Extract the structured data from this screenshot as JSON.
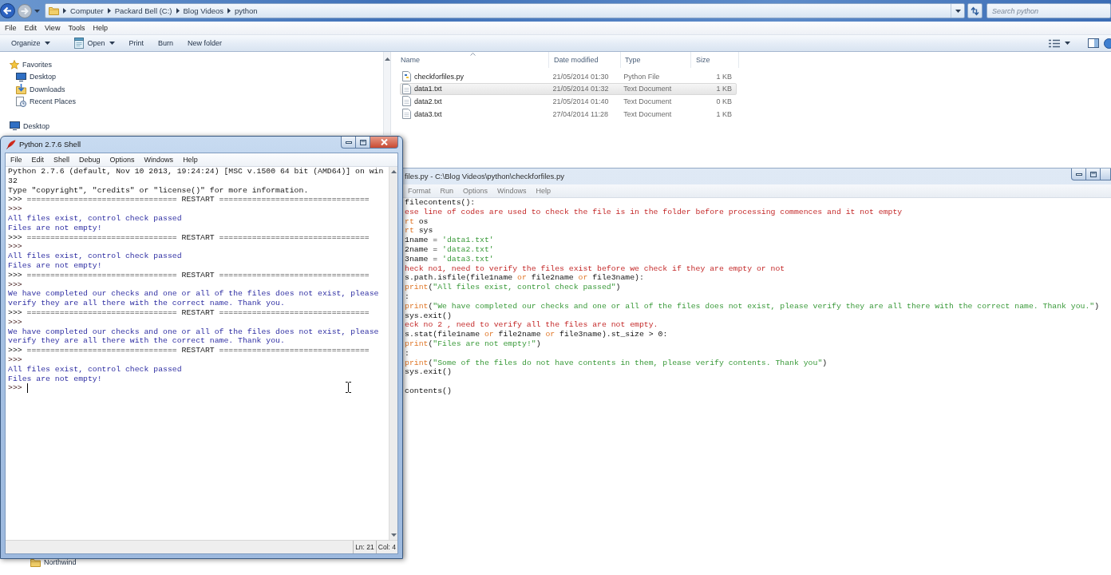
{
  "explorer": {
    "address": {
      "crumbs": [
        "Computer",
        "Packard Bell (C:)",
        "Blog Videos",
        "python"
      ]
    },
    "search": {
      "placeholder": "Search python"
    },
    "menu": [
      "File",
      "Edit",
      "View",
      "Tools",
      "Help"
    ],
    "toolbar": [
      {
        "label": "Organize",
        "kind": "dropdown"
      },
      {
        "label": "Open",
        "kind": "opener"
      },
      {
        "label": "Print",
        "kind": "button"
      },
      {
        "label": "Burn",
        "kind": "button"
      },
      {
        "label": "New folder",
        "kind": "button"
      }
    ],
    "nav": [
      {
        "label": "Favorites",
        "kind": "favorites",
        "children": [
          {
            "label": "Desktop",
            "kind": "desktop"
          },
          {
            "label": "Downloads",
            "kind": "downloads"
          },
          {
            "label": "Recent Places",
            "kind": "recent"
          }
        ]
      },
      {
        "label": "Desktop",
        "kind": "desktop"
      }
    ],
    "nav_tail": [
      {
        "label": "Northwind",
        "kind": "folder"
      }
    ],
    "files": {
      "columns": [
        {
          "label": "Name",
          "sorted": true
        },
        {
          "label": "Date modified",
          "sorted": false
        },
        {
          "label": "Type",
          "sorted": false
        },
        {
          "label": "Size",
          "sorted": false
        }
      ],
      "rows": [
        {
          "kind": "python",
          "selected": false,
          "cells": [
            "checkforfiles.py",
            "21/05/2014 01:30",
            "Python File",
            "1 KB"
          ]
        },
        {
          "kind": "text",
          "selected": true,
          "cells": [
            "data1.txt",
            "21/05/2014 01:32",
            "Text Document",
            "1 KB"
          ]
        },
        {
          "kind": "text",
          "selected": false,
          "cells": [
            "data2.txt",
            "21/05/2014 01:40",
            "Text Document",
            "0 KB"
          ]
        },
        {
          "kind": "text",
          "selected": false,
          "cells": [
            "data3.txt",
            "27/04/2014 11:28",
            "Text Document",
            "1 KB"
          ]
        }
      ]
    }
  },
  "shell": {
    "title": "Python 2.7.6 Shell",
    "menu": [
      "File",
      "Edit",
      "Shell",
      "Debug",
      "Options",
      "Windows",
      "Help"
    ],
    "lines": [
      {
        "kind": "info",
        "text": "Python 2.7.6 (default, Nov 10 2013, 19:24:24) [MSC v.1500 64 bit (AMD64)] on win"
      },
      {
        "kind": "info",
        "text": "32"
      },
      {
        "kind": "info",
        "text": "Type \"copyright\", \"credits\" or \"license()\" for more information."
      },
      {
        "kind": "info",
        "text": ">>> ================================ RESTART ================================"
      },
      {
        "kind": "prompt",
        "text": ">>>",
        "cursor": false
      },
      {
        "kind": "output",
        "text": "All files exist, control check passed"
      },
      {
        "kind": "output",
        "text": "Files are not empty!"
      },
      {
        "kind": "info",
        "text": ">>> ================================ RESTART ================================"
      },
      {
        "kind": "prompt",
        "text": ">>>",
        "cursor": false
      },
      {
        "kind": "output",
        "text": "All files exist, control check passed"
      },
      {
        "kind": "output",
        "text": "Files are not empty!"
      },
      {
        "kind": "info",
        "text": ">>> ================================ RESTART ================================"
      },
      {
        "kind": "prompt",
        "text": ">>>",
        "cursor": false
      },
      {
        "kind": "output",
        "text": "We have completed our checks and one or all of the files does not exist, please"
      },
      {
        "kind": "output",
        "text": "verify they are all there with the correct name. Thank you."
      },
      {
        "kind": "info",
        "text": ">>> ================================ RESTART ================================"
      },
      {
        "kind": "prompt",
        "text": ">>>",
        "cursor": false
      },
      {
        "kind": "output",
        "text": "We have completed our checks and one or all of the files does not exist, please"
      },
      {
        "kind": "output",
        "text": "verify they are all there with the correct name. Thank you."
      },
      {
        "kind": "info",
        "text": ">>> ================================ RESTART ================================"
      },
      {
        "kind": "prompt",
        "text": ">>>",
        "cursor": false
      },
      {
        "kind": "output",
        "text": "All files exist, control check passed"
      },
      {
        "kind": "output",
        "text": "Files are not empty!"
      },
      {
        "kind": "prompt",
        "text": ">>>",
        "cursor": true
      }
    ],
    "status": [
      "Ln: 21",
      "Col: 4"
    ]
  },
  "editor": {
    "title": "files.py - C:\\Blog Videos\\python\\checkforfiles.py",
    "menu": [
      "Format",
      "Run",
      "Options",
      "Windows",
      "Help"
    ],
    "blocks": [
      {
        "lines": [
          [
            {
              "kind": "plain",
              "text": "filecontents():"
            }
          ],
          [
            {
              "kind": "comment",
              "text": "ese line of codes are used to check the file is in the folder before processing commences and it not empty"
            }
          ],
          [
            {
              "kind": "keyword",
              "text": "rt"
            },
            {
              "kind": "plain",
              "text": " os"
            }
          ],
          [
            {
              "kind": "keyword",
              "text": "rt"
            },
            {
              "kind": "plain",
              "text": " sys"
            }
          ],
          [
            {
              "kind": "plain",
              "text": "1name = "
            },
            {
              "kind": "string",
              "text": "'data1.txt'"
            }
          ],
          [
            {
              "kind": "plain",
              "text": "2name = "
            },
            {
              "kind": "string",
              "text": "'data2.txt'"
            }
          ],
          [
            {
              "kind": "plain",
              "text": "3name = "
            },
            {
              "kind": "string",
              "text": "'data3.txt'"
            }
          ],
          [
            {
              "kind": "comment",
              "text": "heck no1, need to verify the files exist before we check if they are empty or not"
            }
          ],
          [
            {
              "kind": "plain",
              "text": "s.path.isfile(file1name "
            },
            {
              "kind": "keyword",
              "text": "or"
            },
            {
              "kind": "plain",
              "text": " file2name "
            },
            {
              "kind": "keyword",
              "text": "or"
            },
            {
              "kind": "plain",
              "text": " file3name):"
            }
          ],
          [
            {
              "kind": "keyword",
              "text": "print"
            },
            {
              "kind": "plain",
              "text": "("
            },
            {
              "kind": "string",
              "text": "\"All files exist, control check passed\""
            },
            {
              "kind": "plain",
              "text": ")"
            }
          ],
          [
            {
              "kind": "plain",
              "text": ":"
            }
          ],
          [
            {
              "kind": "keyword",
              "text": "print"
            },
            {
              "kind": "plain",
              "text": "("
            },
            {
              "kind": "string",
              "text": "\"We have completed our checks and one or all of the files does not exist, please verify they are all there with the correct name. Thank you.\""
            },
            {
              "kind": "plain",
              "text": ")"
            }
          ],
          [
            {
              "kind": "plain",
              "text": "sys.exit()"
            }
          ],
          [
            {
              "kind": "comment",
              "text": "eck no 2 , need to verify all the files are not empty."
            }
          ],
          [
            {
              "kind": "plain",
              "text": "s.stat(file1name "
            },
            {
              "kind": "keyword",
              "text": "or"
            },
            {
              "kind": "plain",
              "text": " file2name "
            },
            {
              "kind": "keyword",
              "text": "or"
            },
            {
              "kind": "plain",
              "text": " file3name).st_size > 0:"
            }
          ],
          [
            {
              "kind": "keyword",
              "text": "print"
            },
            {
              "kind": "plain",
              "text": "("
            },
            {
              "kind": "string",
              "text": "\"Files are not empty!\""
            },
            {
              "kind": "plain",
              "text": ")"
            }
          ],
          [
            {
              "kind": "plain",
              "text": ":"
            }
          ],
          [
            {
              "kind": "keyword",
              "text": "print"
            },
            {
              "kind": "plain",
              "text": "("
            },
            {
              "kind": "string",
              "text": "\"Some of the files do not have contents in them, please verify contents. Thank you\""
            },
            {
              "kind": "plain",
              "text": ")"
            }
          ],
          [
            {
              "kind": "plain",
              "text": "sys.exit()"
            }
          ]
        ]
      },
      {
        "lines": [
          [
            {
              "kind": "plain",
              "text": "contents()"
            }
          ]
        ]
      }
    ]
  }
}
